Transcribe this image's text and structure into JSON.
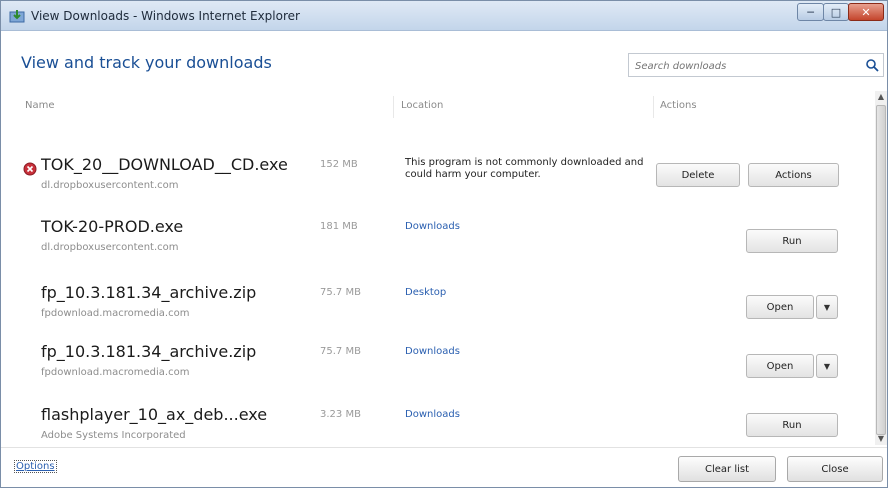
{
  "window": {
    "title": "View Downloads - Windows Internet Explorer",
    "minimize_glyph": "─",
    "maximize_glyph": "□",
    "close_glyph": "✕"
  },
  "header": {
    "title": "View and track your downloads",
    "search_placeholder": "Search downloads"
  },
  "columns": {
    "name": "Name",
    "location": "Location",
    "actions": "Actions"
  },
  "downloads": [
    {
      "name": "TOK_20__DOWNLOAD__CD.exe",
      "source": "dl.dropboxusercontent.com",
      "size": "152 MB",
      "warning": "This program is not commonly downloaded and could harm your computer.",
      "actions": [
        "Delete",
        "Actions"
      ],
      "icon": "warning-icon"
    },
    {
      "name": "TOK-20-PROD.exe",
      "source": "dl.dropboxusercontent.com",
      "size": "181 MB",
      "location": "Downloads",
      "actions": [
        "Run"
      ]
    },
    {
      "name": "fp_10.3.181.34_archive.zip",
      "source": "fpdownload.macromedia.com",
      "size": "75.7 MB",
      "location": "Desktop",
      "actions": [
        "Open"
      ]
    },
    {
      "name": "fp_10.3.181.34_archive.zip",
      "source": "fpdownload.macromedia.com",
      "size": "75.7 MB",
      "location": "Downloads",
      "actions": [
        "Open"
      ]
    },
    {
      "name": "flashplayer_10_ax_deb...exe",
      "source": "Adobe Systems Incorporated",
      "size": "3.23 MB",
      "location": "Downloads",
      "actions": [
        "Run"
      ]
    }
  ],
  "footer": {
    "options_label": "Options",
    "clear_list_label": "Clear list",
    "close_label": "Close"
  },
  "colors": {
    "accent_blue": "#1a4f95",
    "link_blue": "#2a5fb0",
    "close_red": "#c4452c"
  }
}
